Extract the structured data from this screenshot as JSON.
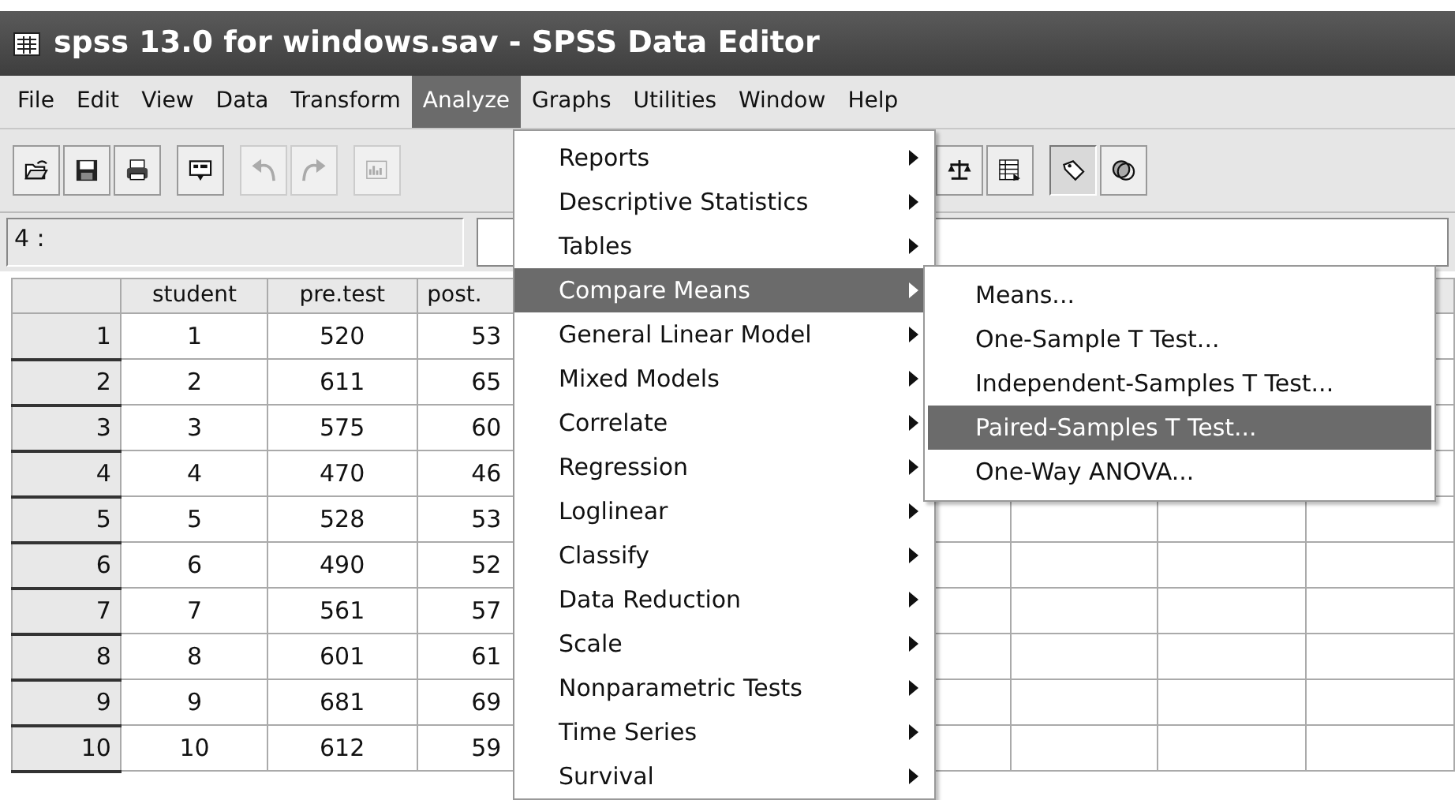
{
  "window": {
    "title": "spss 13.0 for windows.sav - SPSS Data Editor"
  },
  "menubar": [
    {
      "label": "File",
      "selected": false
    },
    {
      "label": "Edit",
      "selected": false
    },
    {
      "label": "View",
      "selected": false
    },
    {
      "label": "Data",
      "selected": false
    },
    {
      "label": "Transform",
      "selected": false
    },
    {
      "label": "Analyze",
      "selected": true
    },
    {
      "label": "Graphs",
      "selected": false
    },
    {
      "label": "Utilities",
      "selected": false
    },
    {
      "label": "Window",
      "selected": false
    },
    {
      "label": "Help",
      "selected": false
    }
  ],
  "toolbar": [
    {
      "kind": "open",
      "disabled": false,
      "pressed": false
    },
    {
      "kind": "save",
      "disabled": false,
      "pressed": false
    },
    {
      "kind": "print",
      "disabled": false,
      "pressed": false
    },
    {
      "kind": "dialog",
      "disabled": false,
      "pressed": false
    },
    {
      "kind": "undo",
      "disabled": true,
      "pressed": false
    },
    {
      "kind": "redo",
      "disabled": true,
      "pressed": false
    },
    {
      "kind": "chart",
      "disabled": true,
      "pressed": false
    },
    {
      "kind": "scale",
      "disabled": false,
      "pressed": false
    },
    {
      "kind": "table",
      "disabled": false,
      "pressed": false
    },
    {
      "kind": "tag",
      "disabled": false,
      "pressed": true
    },
    {
      "kind": "circles",
      "disabled": false,
      "pressed": false
    }
  ],
  "cell_editor": {
    "label": "4 :"
  },
  "grid": {
    "columns": [
      "student",
      "pre.test",
      "post."
    ],
    "rows": [
      {
        "header": "1",
        "cells": [
          "1",
          "520",
          "53"
        ]
      },
      {
        "header": "2",
        "cells": [
          "2",
          "611",
          "65"
        ]
      },
      {
        "header": "3",
        "cells": [
          "3",
          "575",
          "60"
        ]
      },
      {
        "header": "4",
        "cells": [
          "4",
          "470",
          "46"
        ]
      },
      {
        "header": "5",
        "cells": [
          "5",
          "528",
          "53"
        ]
      },
      {
        "header": "6",
        "cells": [
          "6",
          "490",
          "52"
        ]
      },
      {
        "header": "7",
        "cells": [
          "7",
          "561",
          "57"
        ]
      },
      {
        "header": "8",
        "cells": [
          "8",
          "601",
          "61"
        ]
      },
      {
        "header": "9",
        "cells": [
          "9",
          "681",
          "69"
        ]
      },
      {
        "header": "10",
        "cells": [
          "10",
          "612",
          "59"
        ]
      }
    ]
  },
  "analyze_menu": {
    "items": [
      {
        "label": "Reports",
        "selected": false
      },
      {
        "label": "Descriptive Statistics",
        "selected": false
      },
      {
        "label": "Tables",
        "selected": false
      },
      {
        "label": "Compare Means",
        "selected": true
      },
      {
        "label": "General Linear Model",
        "selected": false
      },
      {
        "label": "Mixed Models",
        "selected": false
      },
      {
        "label": "Correlate",
        "selected": false
      },
      {
        "label": "Regression",
        "selected": false
      },
      {
        "label": "Loglinear",
        "selected": false
      },
      {
        "label": "Classify",
        "selected": false
      },
      {
        "label": "Data Reduction",
        "selected": false
      },
      {
        "label": "Scale",
        "selected": false
      },
      {
        "label": "Nonparametric Tests",
        "selected": false
      },
      {
        "label": "Time Series",
        "selected": false
      },
      {
        "label": "Survival",
        "selected": false
      }
    ]
  },
  "compare_means_menu": {
    "items": [
      {
        "label": "Means...",
        "selected": false
      },
      {
        "label": "One-Sample T Test...",
        "selected": false
      },
      {
        "label": "Independent-Samples T Test...",
        "selected": false
      },
      {
        "label": "Paired-Samples T Test...",
        "selected": true
      },
      {
        "label": "One-Way ANOVA...",
        "selected": false
      }
    ]
  }
}
